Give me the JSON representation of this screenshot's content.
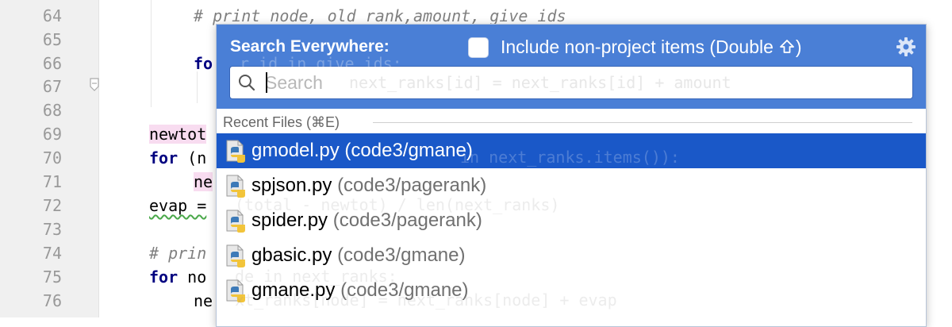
{
  "editor": {
    "line_numbers": [
      "64",
      "65",
      "66",
      "67",
      "68",
      "69",
      "70",
      "71",
      "72",
      "73",
      "74",
      "75",
      "76"
    ],
    "code": {
      "l64": "# print node, old_rank,amount, give_ids",
      "l66_kw": "fo",
      "l67_text": "",
      "l69": "newtot",
      "l70_kw": "for",
      "l70_rest": " (n",
      "l71": "ne",
      "l72": "evap =",
      "l74": "# prin",
      "l75_kw": "for",
      "l75_rest": " no",
      "l76": "ne"
    },
    "behind_text": {
      "l66": "r id in give_ids:",
      "l67": "next_ranks[id] = next_ranks[id] + amount",
      "l70": "in next_ranks.items()):",
      "l72": "(total - newtot) / len(next_ranks)",
      "l75": "de in next_ranks:",
      "l76": "xt_ranks[node] = next_ranks[node] + evap"
    }
  },
  "popup": {
    "title": "Search Everywhere:",
    "include_checkbox": {
      "label": "Include non-project items (Double",
      "checked": false
    },
    "search": {
      "placeholder": "Search",
      "value": ""
    },
    "section_title": "Recent Files (⌘E)",
    "results": [
      {
        "name": "gmodel.py",
        "path": "(code3/gmane)",
        "selected": true
      },
      {
        "name": "spjson.py",
        "path": "(code3/pagerank)",
        "selected": false
      },
      {
        "name": "spider.py",
        "path": "(code3/pagerank)",
        "selected": false
      },
      {
        "name": "gbasic.py",
        "path": "(code3/gmane)",
        "selected": false
      },
      {
        "name": "gmane.py",
        "path": "(code3/gmane)",
        "selected": false
      }
    ]
  },
  "colors": {
    "header_bg": "#4a7fd6",
    "selection_bg": "#1a58c8",
    "keyword": "#000080",
    "comment": "#808080"
  },
  "icons": {
    "file_icon": "python-file-icon",
    "settings": "gear-icon",
    "search": "search-icon",
    "shift": "shift-icon"
  }
}
